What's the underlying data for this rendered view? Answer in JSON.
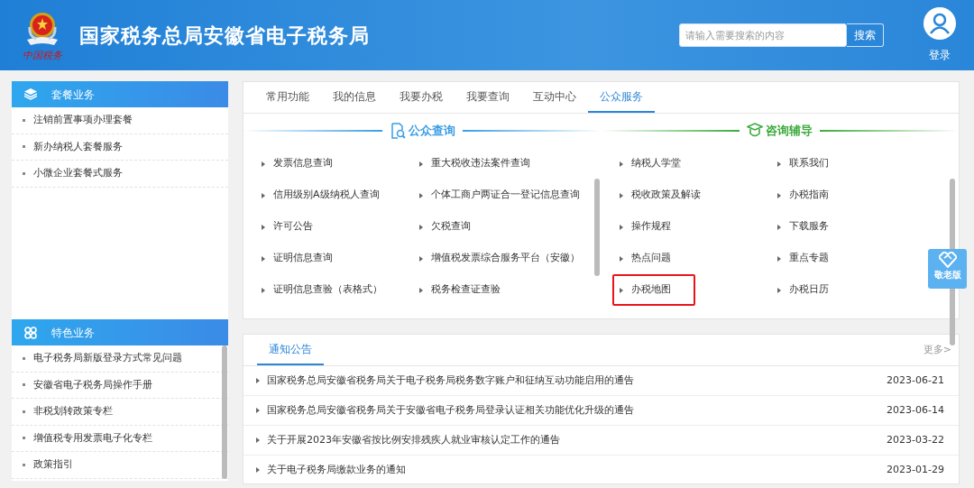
{
  "header": {
    "title": "国家税务总局安徽省电子税务局",
    "logo_caption": "中国税务",
    "search": {
      "placeholder": "请输入需要搜索的内容",
      "button": "搜索"
    },
    "login": "登录"
  },
  "sidebar": [
    {
      "title": "套餐业务",
      "items": [
        "注销前置事项办理套餐",
        "新办纳税人套餐服务",
        "小微企业套餐式服务"
      ]
    },
    {
      "title": "特色业务",
      "items": [
        "电子税务局新版登录方式常见问题",
        "安徽省电子税务局操作手册",
        "非税划转政策专栏",
        "增值税专用发票电子化专栏",
        "政策指引"
      ]
    }
  ],
  "tabs": [
    {
      "label": "常用功能",
      "selected": false
    },
    {
      "label": "我的信息",
      "selected": false
    },
    {
      "label": "我要办税",
      "selected": false
    },
    {
      "label": "我要查询",
      "selected": false
    },
    {
      "label": "互动中心",
      "selected": false
    },
    {
      "label": "公众服务",
      "selected": true
    }
  ],
  "sections": [
    {
      "title": "公众查询",
      "color": "#3a9ee4",
      "items": [
        {
          "label": "发票信息查询",
          "highlighted": false
        },
        {
          "label": "重大税收违法案件查询",
          "highlighted": false
        },
        {
          "label": "信用级别A级纳税人查询",
          "highlighted": false
        },
        {
          "label": "个体工商户两证合一登记信息查询",
          "highlighted": false
        },
        {
          "label": "许可公告",
          "highlighted": false
        },
        {
          "label": "欠税查询",
          "highlighted": false
        },
        {
          "label": "证明信息查询",
          "highlighted": false
        },
        {
          "label": "增值税发票综合服务平台（安徽）",
          "highlighted": false
        },
        {
          "label": "证明信息查验（表格式）",
          "highlighted": false
        },
        {
          "label": "税务检查证查验",
          "highlighted": false
        }
      ]
    },
    {
      "title": "咨询辅导",
      "color": "#3bab3b",
      "items": [
        {
          "label": "纳税人学堂",
          "highlighted": false
        },
        {
          "label": "联系我们",
          "highlighted": false
        },
        {
          "label": "税收政策及解读",
          "highlighted": false
        },
        {
          "label": "办税指南",
          "highlighted": false
        },
        {
          "label": "操作规程",
          "highlighted": false
        },
        {
          "label": "下载服务",
          "highlighted": false
        },
        {
          "label": "热点问题",
          "highlighted": false
        },
        {
          "label": "重点专题",
          "highlighted": false
        },
        {
          "label": "办税地图",
          "highlighted": true
        },
        {
          "label": "办税日历",
          "highlighted": false
        }
      ]
    }
  ],
  "elder_button": "敬老版",
  "notices": {
    "tab": {
      "label": "通知公告",
      "selected": true
    },
    "more": "更多>",
    "rows": [
      {
        "title": "国家税务总局安徽省税务局关于电子税务局税务数字账户和征纳互动功能启用的通告",
        "date": "2023-06-21"
      },
      {
        "title": "国家税务总局安徽省税务局关于安徽省电子税务局登录认证相关功能优化升级的通告",
        "date": "2023-06-14"
      },
      {
        "title": "关于开展2023年安徽省按比例安排残疾人就业审核认定工作的通告",
        "date": "2023-03-22"
      },
      {
        "title": "关于电子税务局缴款业务的通知",
        "date": "2023-01-29"
      }
    ]
  }
}
